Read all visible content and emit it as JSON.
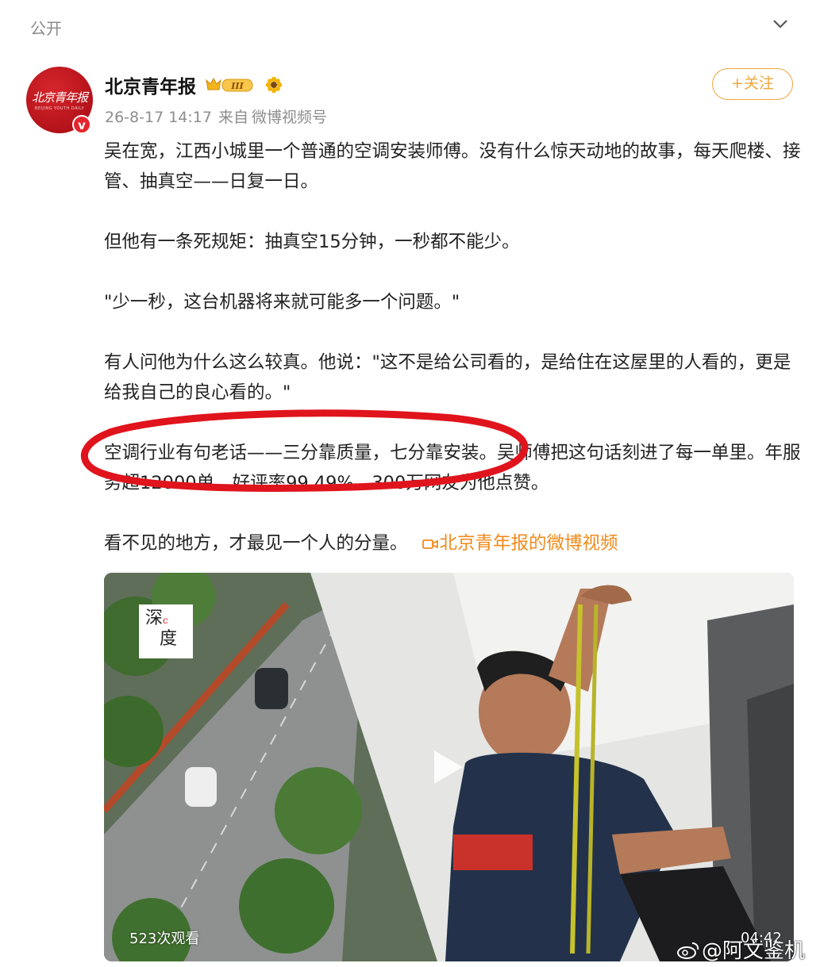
{
  "header": {
    "visibility_label": "公开",
    "collapse_icon": "chevron-down-icon"
  },
  "post": {
    "author": "北京青年报",
    "avatar_text": "北京青年报",
    "avatar_sub": "BEIJING YOUTH DAILY",
    "verified_icon": "v-verified-icon",
    "level_badge": "III",
    "timestamp": "26-8-17 14:17",
    "source_prefix": "来自",
    "source": "微博视频号",
    "follow_label": "+关注",
    "paragraphs": [
      "吴在宽，江西小城里一个普通的空调安装师傅。没有什么惊天动地的故事，每天爬楼、接管、抽真空——日复一日。",
      "但他有一条死规矩：抽真空15分钟，一秒都不能少。",
      "\"少一秒，这台机器将来就可能多一个问题。\"",
      "有人问他为什么这么较真。他说：\"这不是给公司看的，是给住在这屋里的人看的，更是给我自己的良心看的。\"",
      "空调行业有句老话——三分靠质量，七分靠安装。吴师傅把这句话刻进了每一单里。年服务超12000单，好评率99.49%，300万网友为他点赞。",
      "看不见的地方，才最见一个人的分量。"
    ],
    "video_link_label": "北京青年报的微博视频",
    "accent_color": "#f08a1c"
  },
  "video": {
    "logo_text_top": "深",
    "logo_text_mid": "c",
    "logo_text_bottom": "度",
    "views": "523次观看",
    "duration": "04:42",
    "play_icon": "play-icon"
  },
  "watermark": {
    "text": "@阿文鉴机",
    "icon": "weibo-logo-icon"
  }
}
